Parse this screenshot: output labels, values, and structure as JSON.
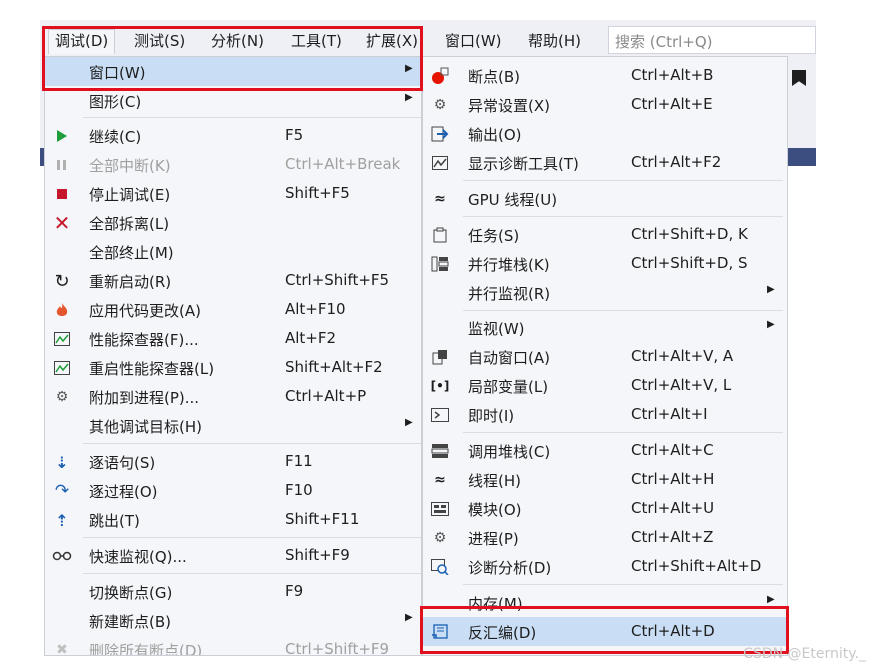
{
  "menubar": {
    "items": [
      {
        "label": "调试(D)"
      },
      {
        "label": "测试(S)"
      },
      {
        "label": "分析(N)"
      },
      {
        "label": "工具(T)"
      },
      {
        "label": "扩展(X)"
      },
      {
        "label": "窗口(W)"
      },
      {
        "label": "帮助(H)"
      }
    ],
    "search_placeholder": "搜索 (Ctrl+Q)"
  },
  "debug_menu": {
    "items": [
      {
        "label": "窗口(W)",
        "shortcut": "",
        "submenu": true,
        "icon": "none",
        "highlighted": true
      },
      {
        "label": "图形(C)",
        "shortcut": "",
        "submenu": true,
        "icon": "none"
      },
      {
        "label": "继续(C)",
        "shortcut": "F5",
        "icon": "play-icon"
      },
      {
        "label": "全部中断(K)",
        "shortcut": "Ctrl+Alt+Break",
        "icon": "pause-icon",
        "disabled": true
      },
      {
        "label": "停止调试(E)",
        "shortcut": "Shift+F5",
        "icon": "stop-icon"
      },
      {
        "label": "全部拆离(L)",
        "shortcut": "",
        "icon": "detach-icon"
      },
      {
        "label": "全部终止(M)",
        "shortcut": "",
        "icon": "none"
      },
      {
        "label": "重新启动(R)",
        "shortcut": "Ctrl+Shift+F5",
        "icon": "restart-icon"
      },
      {
        "label": "应用代码更改(A)",
        "shortcut": "Alt+F10",
        "icon": "hot-reload-icon"
      },
      {
        "label": "性能探查器(F)...",
        "shortcut": "Alt+F2",
        "icon": "profiler-icon"
      },
      {
        "label": "重启性能探查器(L)",
        "shortcut": "Shift+Alt+F2",
        "icon": "profiler-icon"
      },
      {
        "label": "附加到进程(P)...",
        "shortcut": "Ctrl+Alt+P",
        "icon": "attach-icon"
      },
      {
        "label": "其他调试目标(H)",
        "shortcut": "",
        "submenu": true,
        "icon": "none"
      },
      {
        "label": "逐语句(S)",
        "shortcut": "F11",
        "icon": "step-into-icon"
      },
      {
        "label": "逐过程(O)",
        "shortcut": "F10",
        "icon": "step-over-icon"
      },
      {
        "label": "跳出(T)",
        "shortcut": "Shift+F11",
        "icon": "step-out-icon"
      },
      {
        "label": "快速监视(Q)...",
        "shortcut": "Shift+F9",
        "icon": "glasses-icon"
      },
      {
        "label": "切换断点(G)",
        "shortcut": "F9",
        "icon": "none"
      },
      {
        "label": "新建断点(B)",
        "shortcut": "",
        "submenu": true,
        "icon": "none"
      },
      {
        "label": "删除所有断点(D)",
        "shortcut": "Ctrl+Shift+F9",
        "icon": "delete-breakpoints-icon",
        "disabled": true
      }
    ]
  },
  "window_menu": {
    "items": [
      {
        "label": "断点(B)",
        "shortcut": "Ctrl+Alt+B",
        "icon": "breakpoint-icon"
      },
      {
        "label": "异常设置(X)",
        "shortcut": "Ctrl+Alt+E",
        "icon": "exception-settings-icon"
      },
      {
        "label": "输出(O)",
        "shortcut": "",
        "icon": "output-icon"
      },
      {
        "label": "显示诊断工具(T)",
        "shortcut": "Ctrl+Alt+F2",
        "icon": "diagnostics-icon"
      },
      {
        "label": "GPU 线程(U)",
        "shortcut": "",
        "icon": "threads-icon"
      },
      {
        "label": "任务(S)",
        "shortcut": "Ctrl+Shift+D, K",
        "icon": "tasks-icon"
      },
      {
        "label": "并行堆栈(K)",
        "shortcut": "Ctrl+Shift+D, S",
        "icon": "parallel-stacks-icon"
      },
      {
        "label": "并行监视(R)",
        "shortcut": "",
        "submenu": true,
        "icon": "none"
      },
      {
        "label": "监视(W)",
        "shortcut": "",
        "submenu": true,
        "icon": "none"
      },
      {
        "label": "自动窗口(A)",
        "shortcut": "Ctrl+Alt+V, A",
        "icon": "autos-icon"
      },
      {
        "label": "局部变量(L)",
        "shortcut": "Ctrl+Alt+V, L",
        "icon": "locals-icon"
      },
      {
        "label": "即时(I)",
        "shortcut": "Ctrl+Alt+I",
        "icon": "immediate-icon"
      },
      {
        "label": "调用堆栈(C)",
        "shortcut": "Ctrl+Alt+C",
        "icon": "call-stack-icon"
      },
      {
        "label": "线程(H)",
        "shortcut": "Ctrl+Alt+H",
        "icon": "threads-icon"
      },
      {
        "label": "模块(O)",
        "shortcut": "Ctrl+Alt+U",
        "icon": "modules-icon"
      },
      {
        "label": "进程(P)",
        "shortcut": "Ctrl+Alt+Z",
        "icon": "processes-icon"
      },
      {
        "label": "诊断分析(D)",
        "shortcut": "Ctrl+Shift+Alt+D",
        "icon": "diagnostic-analysis-icon"
      },
      {
        "label": "内存(M)",
        "shortcut": "",
        "submenu": true,
        "icon": "none"
      },
      {
        "label": "反汇编(D)",
        "shortcut": "Ctrl+Alt+D",
        "icon": "disassembly-icon",
        "highlighted": true
      }
    ]
  },
  "watermark": "CSDN @Eternity._"
}
